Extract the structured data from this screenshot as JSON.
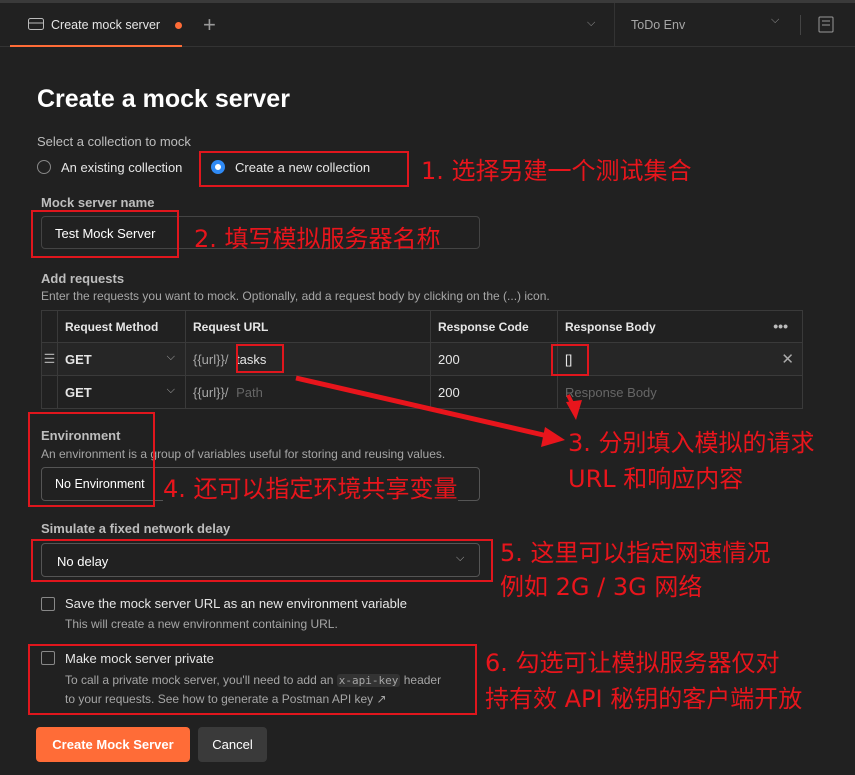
{
  "tab": {
    "title": "Create mock server",
    "env": "ToDo Env"
  },
  "page": {
    "title": "Create a mock server"
  },
  "collection": {
    "label": "Select a collection to mock",
    "option_existing": "An existing collection",
    "option_new": "Create a new collection",
    "selected": "new"
  },
  "name": {
    "label": "Mock server name",
    "value": "Test Mock Server"
  },
  "requests": {
    "label": "Add requests",
    "hint": "Enter the requests you want to mock. Optionally, add a request body by clicking on the (...) icon.",
    "headers": [
      "Request Method",
      "Request URL",
      "Response Code",
      "Response Body"
    ],
    "url_prefix": "{{url}}/",
    "rows": [
      {
        "method": "GET",
        "path": "tasks",
        "code": "200",
        "body": "[]"
      },
      {
        "method": "GET",
        "path_placeholder": "Path",
        "code": "200",
        "body_placeholder": "Response Body"
      }
    ]
  },
  "environment": {
    "label": "Environment",
    "hint": "An environment is a group of variables useful for storing and reusing values.",
    "value": "No Environment"
  },
  "delay": {
    "label": "Simulate a fixed network delay",
    "value": "No delay"
  },
  "save_env": {
    "label": "Save the mock server URL as an new environment variable",
    "hint": "This will create a new environment containing URL.",
    "checked": false
  },
  "private": {
    "label": "Make mock server private",
    "hint1": "To call a private mock server, you'll need to add an",
    "code": "x-api-key",
    "hint2": "header",
    "hint3": "to your requests. See how to generate a Postman API key ↗",
    "checked": false
  },
  "buttons": {
    "create": "Create Mock Server",
    "cancel": "Cancel"
  },
  "annotations": {
    "a1": "1. 选择另建一个测试集合",
    "a2": "2. 填写模拟服务器名称",
    "a3a": "3. 分别填入模拟的请求",
    "a3b": "URL 和响应内容",
    "a4": "4. 还可以指定环境共享变量",
    "a5a": "5. 这里可以指定网速情况",
    "a5b": "例如 2G / 3G 网络",
    "a6a": "6. 勾选可让模拟服务器仅对",
    "a6b": "持有效 API 秘钥的客户端开放"
  },
  "colors": {
    "accent": "#ff6c37",
    "annotation": "#e8151c"
  }
}
